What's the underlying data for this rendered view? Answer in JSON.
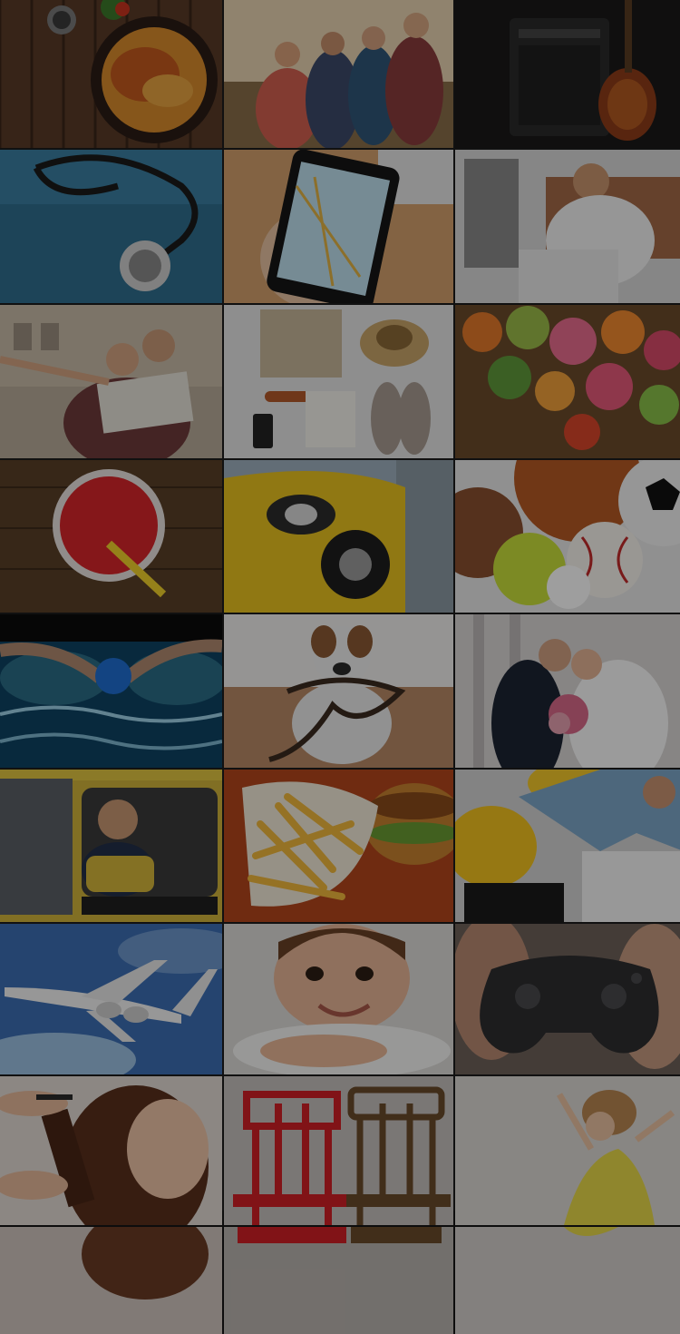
{
  "screen": {
    "kind": "photo-mosaic-background",
    "overlay_color": "#000000"
  },
  "tiles": [
    {
      "subject": "pasta-bowl",
      "bg": "#5a3b28"
    },
    {
      "subject": "friends-group",
      "bg": "#c8b08c"
    },
    {
      "subject": "guitar-amp",
      "bg": "#1e1c1c"
    },
    {
      "subject": "stethoscope",
      "bg": "#2f6f8f"
    },
    {
      "subject": "phone-map",
      "bg": "#b9875a"
    },
    {
      "subject": "man-laptop",
      "bg": "#c9c9c9"
    },
    {
      "subject": "travelers-map",
      "bg": "#a39a8c"
    },
    {
      "subject": "travel-items",
      "bg": "#cfcfcf"
    },
    {
      "subject": "flower-bouquet",
      "bg": "#6b4b2b"
    },
    {
      "subject": "red-drink",
      "bg": "#4d3624"
    },
    {
      "subject": "yellow-car",
      "bg": "#d7b11c"
    },
    {
      "subject": "sport-balls",
      "bg": "#9a6a4a"
    },
    {
      "subject": "swimmer",
      "bg": "#11364a"
    },
    {
      "subject": "dog-leash",
      "bg": "#a38a72"
    },
    {
      "subject": "wedding-couple",
      "bg": "#d6d2d2"
    },
    {
      "subject": "taxi-driver",
      "bg": "#c2a92a"
    },
    {
      "subject": "fries-burger",
      "bg": "#a8421c"
    },
    {
      "subject": "builders",
      "bg": "#c9c9c9"
    },
    {
      "subject": "airplane",
      "bg": "#3d6fb4"
    },
    {
      "subject": "child-smile",
      "bg": "#d8d6d3"
    },
    {
      "subject": "gamepad",
      "bg": "#6b5a50"
    },
    {
      "subject": "hairdresser",
      "bg": "#d2c7c0"
    },
    {
      "subject": "chairs",
      "bg": "#b8b3b0"
    },
    {
      "subject": "dancer",
      "bg": "#d5d2cf"
    }
  ]
}
